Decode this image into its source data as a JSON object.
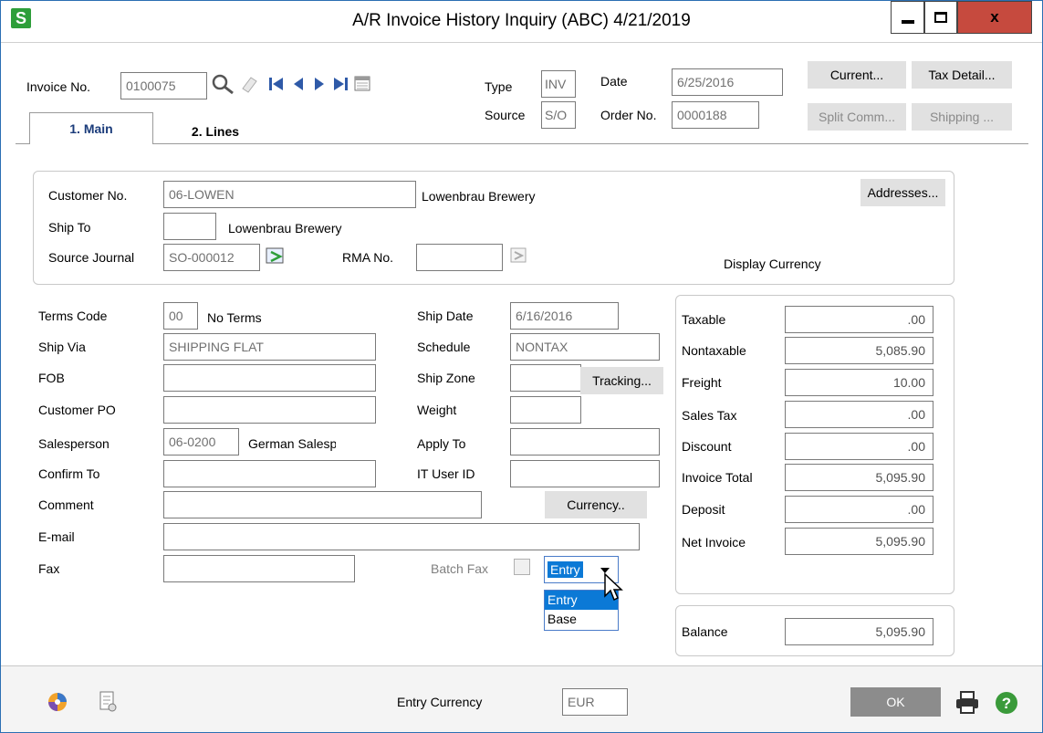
{
  "window": {
    "title": "A/R Invoice History Inquiry (ABC) 4/21/2019",
    "app_icon": "S",
    "close_label": "x"
  },
  "header": {
    "invoice_label": "Invoice No.",
    "invoice_value": "0100075",
    "type_label": "Type",
    "type_value": "INV",
    "date_label": "Date",
    "date_value": "6/25/2016",
    "source_label": "Source",
    "source_value": "S/O",
    "order_label": "Order No.",
    "order_value": "0000188",
    "buttons": {
      "current": "Current...",
      "tax_detail": "Tax Detail...",
      "split_comm": "Split Comm...",
      "shipping": "Shipping ..."
    }
  },
  "tabs": [
    {
      "label": "1. Main",
      "active": true
    },
    {
      "label": "2. Lines",
      "active": false
    }
  ],
  "customer": {
    "customer_no_label": "Customer No.",
    "customer_no_value": "06-LOWEN",
    "customer_name": "Lowenbrau Brewery",
    "ship_to_label": "Ship To",
    "ship_to_value": "",
    "ship_to_name": "Lowenbrau Brewery",
    "source_journal_label": "Source Journal",
    "source_journal_value": "SO-000012",
    "rma_label": "RMA No.",
    "rma_value": "",
    "addresses_button": "Addresses...",
    "display_currency_label": "Display Currency"
  },
  "details": {
    "terms_code_label": "Terms Code",
    "terms_code_value": "00",
    "terms_desc": "No Terms",
    "ship_via_label": "Ship Via",
    "ship_via_value": "SHIPPING FLAT",
    "fob_label": "FOB",
    "fob_value": "",
    "customer_po_label": "Customer PO",
    "customer_po_value": "",
    "salesperson_label": "Salesperson",
    "salesperson_value": "06-0200",
    "salesperson_name": "German Salespers",
    "confirm_to_label": "Confirm To",
    "confirm_to_value": "",
    "comment_label": "Comment",
    "comment_value": "",
    "email_label": "E-mail",
    "email_value": "",
    "fax_label": "Fax",
    "fax_value": "",
    "ship_date_label": "Ship Date",
    "ship_date_value": "6/16/2016",
    "schedule_label": "Schedule",
    "schedule_value": "NONTAX",
    "ship_zone_label": "Ship Zone",
    "ship_zone_value": "",
    "tracking_button": "Tracking...",
    "weight_label": "Weight",
    "weight_value": "",
    "apply_to_label": "Apply To",
    "apply_to_value": "",
    "it_user_label": "IT User ID",
    "it_user_value": "",
    "currency_button": "Currency..",
    "batch_fax_label": "Batch Fax",
    "display_currency_selected": "Entry",
    "display_currency_options": [
      "Entry",
      "Base"
    ]
  },
  "totals": {
    "taxable_label": "Taxable",
    "taxable_value": ".00",
    "nontaxable_label": "Nontaxable",
    "nontaxable_value": "5,085.90",
    "freight_label": "Freight",
    "freight_value": "10.00",
    "sales_tax_label": "Sales Tax",
    "sales_tax_value": ".00",
    "discount_label": "Discount",
    "discount_value": ".00",
    "invoice_total_label": "Invoice Total",
    "invoice_total_value": "5,095.90",
    "deposit_label": "Deposit",
    "deposit_value": ".00",
    "net_invoice_label": "Net Invoice",
    "net_invoice_value": "5,095.90",
    "balance_label": "Balance",
    "balance_value": "5,095.90"
  },
  "footer": {
    "entry_currency_label": "Entry Currency",
    "entry_currency_value": "EUR",
    "ok_button": "OK"
  },
  "colors": {
    "accent": "#0b79d6",
    "close": "#c64a3e",
    "ok_button": "#8c8c8c",
    "app_icon": "#2e9e3a"
  }
}
